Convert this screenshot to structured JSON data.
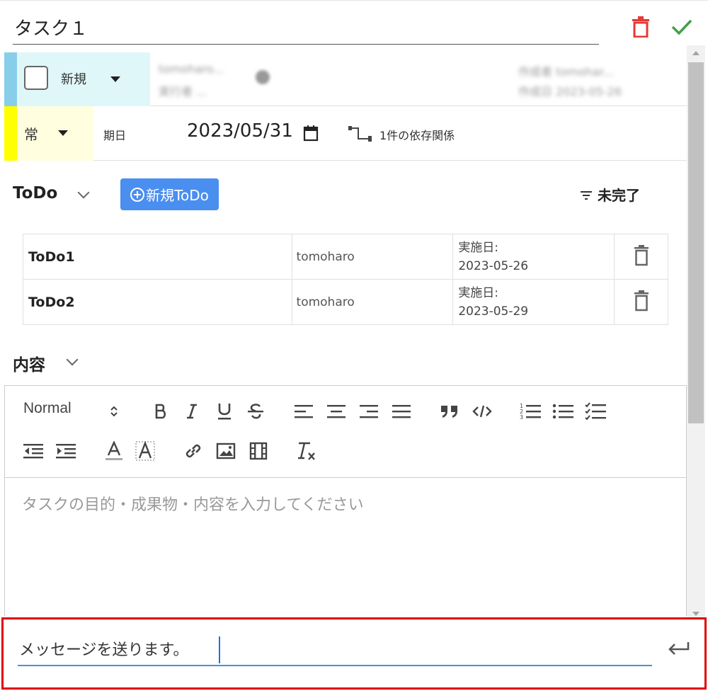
{
  "task": {
    "title": "タスク１",
    "icons": {
      "delete": "trash-icon",
      "confirm": "check-icon"
    }
  },
  "status": {
    "checked": false,
    "label": "新規",
    "color": "#87ceeb"
  },
  "blurred_meta": {
    "assignee_line1": "tomoharo...",
    "assignee_line2": "実行者 ...",
    "creator_line1": "作成者 tomohar...",
    "creator_line2": "作成日 2023-05-26"
  },
  "priority": {
    "label": "常",
    "color": "#ffff00"
  },
  "due": {
    "label": "期日",
    "value": "2023/05/31"
  },
  "dependency": {
    "label": "1件の依存関係"
  },
  "todo_section": {
    "title": "ToDo",
    "new_button": "新規ToDo",
    "filter_label": "未完了",
    "items": [
      {
        "name": "ToDo1",
        "user": "tomoharo",
        "date_label": "実施日:",
        "date": "2023-05-26"
      },
      {
        "name": "ToDo2",
        "user": "tomoharo",
        "date_label": "実施日:",
        "date": "2023-05-29"
      }
    ]
  },
  "content_section": {
    "title": "内容",
    "toolbar": {
      "heading_select": "Normal"
    },
    "placeholder": "タスクの目的・成果物・内容を入力してください"
  },
  "message": {
    "value": "メッセージを送ります。",
    "send_icon": "enter-icon"
  }
}
